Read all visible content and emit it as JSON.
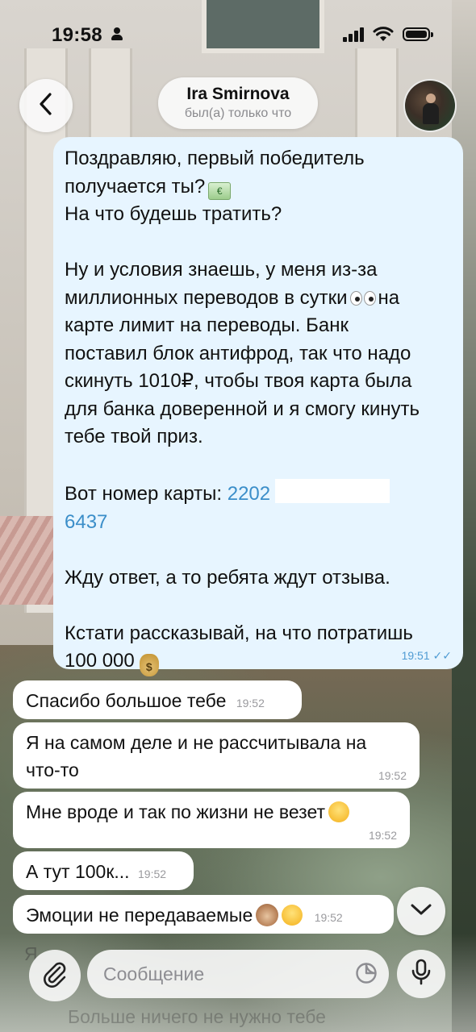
{
  "status_bar": {
    "time": "19:58"
  },
  "header": {
    "contact_name": "Ira Smirnova",
    "contact_status": "был(а) только что",
    "icons": {
      "back": "chevron-left-icon",
      "avatar": "avatar"
    }
  },
  "outgoing_message": {
    "line1": "Поздравляю, первый победитель",
    "line2": "получается ты?",
    "line3": "На что будешь тратить?",
    "line4": "Ну и условия знаешь, у меня из-за",
    "line5a": "миллионных переводов в сутки",
    "line5b": "на",
    "line6": "карте лимит на переводы. Банк",
    "line7": "поставил блок антифрод, так что надо",
    "line8": "скинуть 1010₽, чтобы твоя карта была",
    "line9": "для банка доверенной и я смогу кинуть",
    "line10": "тебе твой приз.",
    "card_label": "Вот номер карты: ",
    "card_part1": "2202",
    "card_part2": "6437",
    "line12": "Жду ответ, а то ребята ждут отзыва.",
    "line13": "Кстати рассказывай, на что потратишь",
    "line14": "100 000",
    "time": "19:51",
    "read_mark": "✓✓"
  },
  "incoming_messages": [
    {
      "text": "Спасибо большое тебе",
      "time": "19:52"
    },
    {
      "text_line1": "Я на самом деле и не рассчитывала на",
      "text_line2": "что-то",
      "time": "19:52"
    },
    {
      "text": "Мне вроде и так по жизни не везет",
      "time": "19:52"
    },
    {
      "text": "А тут 100к...",
      "time": "19:52"
    },
    {
      "text": "Эмоции не передаваемые",
      "time": "19:52"
    }
  ],
  "composer": {
    "placeholder": "Сообщение",
    "ghost_left": "Я",
    "ghost_bottom": "Больше ничего не нужно тебе"
  },
  "colors": {
    "outgoing_bubble": "#e7f5ff",
    "incoming_bubble": "#ffffff",
    "link": "#3b8ec9",
    "outgoing_meta": "#4f9bd3"
  }
}
